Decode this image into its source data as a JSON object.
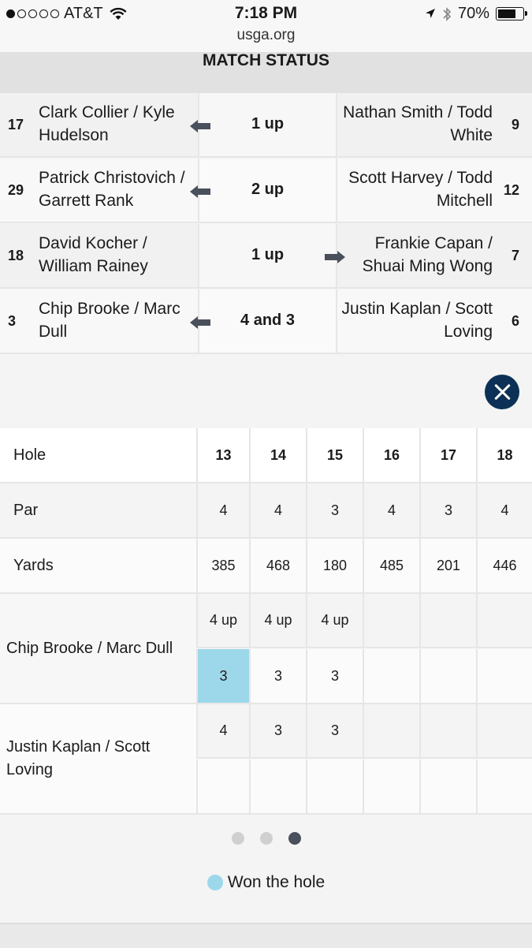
{
  "status_bar": {
    "carrier": "AT&T",
    "time": "7:18 PM",
    "battery": "70%"
  },
  "url_bar": {
    "domain": "usga.org"
  },
  "match_status": {
    "title": "MATCH STATUS",
    "matches": [
      {
        "left_seed": "17",
        "left_team": "Clark Collier / Kyle Hudelson",
        "result": "1 up",
        "leader": "left",
        "right_team": "Nathan Smith / Todd White",
        "right_seed": "9"
      },
      {
        "left_seed": "29",
        "left_team": "Patrick Christovich / Garrett Rank",
        "result": "2 up",
        "leader": "left",
        "right_team": "Scott Harvey / Todd Mitchell",
        "right_seed": "12"
      },
      {
        "left_seed": "18",
        "left_team": "David Kocher / William Rainey",
        "result": "1 up",
        "leader": "right",
        "right_team": "Frankie Capan / Shuai Ming Wong",
        "right_seed": "7"
      },
      {
        "left_seed": "3",
        "left_team": "Chip Brooke / Marc Dull",
        "result": "4 and 3",
        "leader": "left",
        "right_team": "Justin Kaplan / Scott Loving",
        "right_seed": "6"
      }
    ]
  },
  "scorecard": {
    "labels": {
      "hole": "Hole",
      "par": "Par",
      "yards": "Yards"
    },
    "holes": [
      "13",
      "14",
      "15",
      "16",
      "17",
      "18"
    ],
    "par": [
      "4",
      "4",
      "3",
      "4",
      "3",
      "4"
    ],
    "yards": [
      "385",
      "468",
      "180",
      "485",
      "201",
      "446"
    ],
    "teams": [
      {
        "name": "Chip Brooke / Marc Dull",
        "status": [
          "4 up",
          "4 up",
          "4 up",
          "",
          "",
          ""
        ],
        "scores": [
          "3",
          "3",
          "3",
          "",
          "",
          ""
        ],
        "won_holes": [
          "13"
        ]
      },
      {
        "name": "Justin Kaplan / Scott Loving",
        "status": [
          "4",
          "3",
          "3",
          "",
          "",
          ""
        ],
        "scores": [
          "",
          "",
          "",
          "",
          "",
          ""
        ],
        "won_holes": []
      }
    ]
  },
  "pager": {
    "count": 3,
    "active": 3
  },
  "legend": {
    "won_label": "Won the hole",
    "won_color": "#9dd8ea"
  },
  "colors": {
    "close_button": "#0d3156",
    "arrow": "#4a4f5c"
  },
  "icons": {
    "close": "close-x-icon",
    "arrow": "arrow-icon"
  }
}
